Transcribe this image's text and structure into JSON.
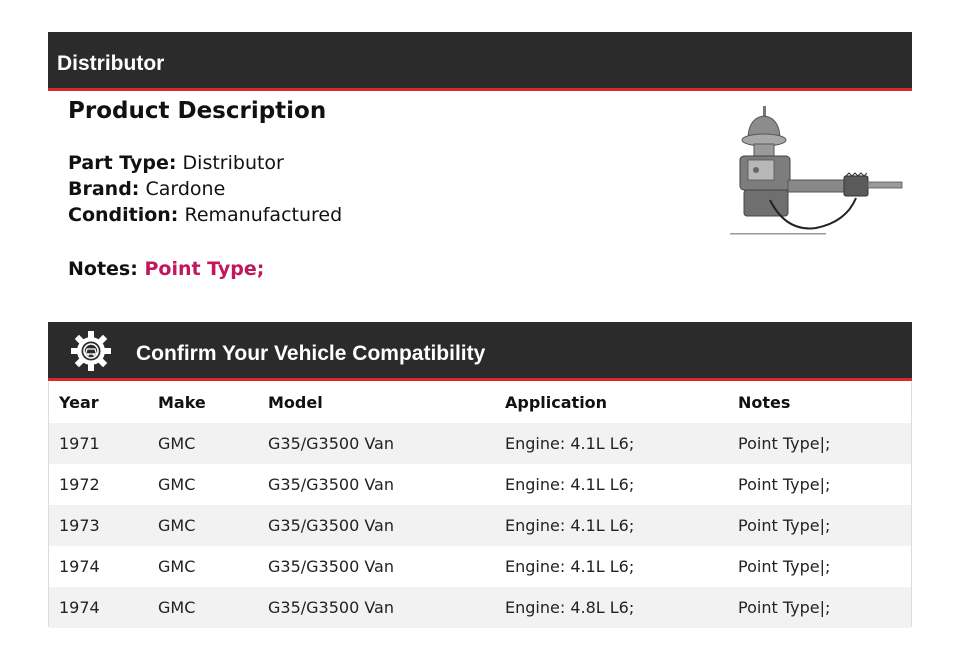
{
  "header": {
    "title": "Distributor"
  },
  "description": {
    "heading": "Product Description",
    "part_type_label": "Part Type:",
    "part_type_value": "Distributor",
    "brand_label": "Brand:",
    "brand_value": "Cardone",
    "condition_label": "Condition:",
    "condition_value": "Remanufactured",
    "notes_label": "Notes:",
    "notes_value": "Point Type;",
    "notes_color": "#c2185b"
  },
  "compatibility": {
    "title": "Confirm Your Vehicle Compatibility",
    "icon": "gear-car-icon",
    "columns": [
      "Year",
      "Make",
      "Model",
      "Application",
      "Notes"
    ],
    "rows": [
      [
        "1971",
        "GMC",
        "G35/G3500 Van",
        "Engine: 4.1L L6;",
        "Point Type|;"
      ],
      [
        "1972",
        "GMC",
        "G35/G3500 Van",
        "Engine: 4.1L L6;",
        "Point Type|;"
      ],
      [
        "1973",
        "GMC",
        "G35/G3500 Van",
        "Engine: 4.1L L6;",
        "Point Type|;"
      ],
      [
        "1974",
        "GMC",
        "G35/G3500 Van",
        "Engine: 4.1L L6;",
        "Point Type|;"
      ],
      [
        "1974",
        "GMC",
        "G35/G3500 Van",
        "Engine: 4.8L L6;",
        "Point Type|;"
      ]
    ]
  },
  "colors": {
    "bar": "#2b2b2b",
    "accent": "#d42a2a"
  }
}
